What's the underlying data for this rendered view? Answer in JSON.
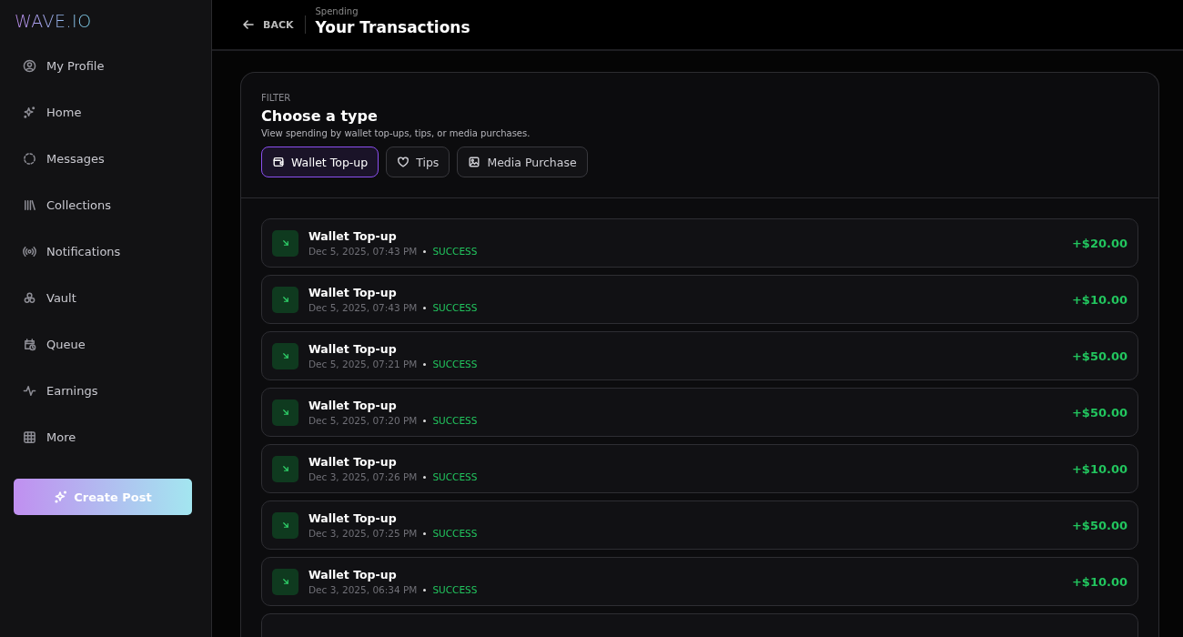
{
  "logo": "WAVE.IO",
  "sidebar": {
    "items": [
      {
        "label": "My Profile"
      },
      {
        "label": "Home"
      },
      {
        "label": "Messages"
      },
      {
        "label": "Collections"
      },
      {
        "label": "Notifications"
      },
      {
        "label": "Vault"
      },
      {
        "label": "Queue"
      },
      {
        "label": "Earnings"
      },
      {
        "label": "More"
      }
    ],
    "button": "Create Post"
  },
  "header": {
    "back": "BACK",
    "overline": "Spending",
    "title": "Your Transactions"
  },
  "filter": {
    "overline": "FILTER",
    "title": "Choose a type",
    "description": "View spending by wallet top-ups, tips, or media purchases.",
    "options": [
      {
        "label": "Wallet Top-up",
        "selected": true
      },
      {
        "label": "Tips",
        "selected": false
      },
      {
        "label": "Media Purchase",
        "selected": false
      }
    ]
  },
  "transactions": [
    {
      "title": "Wallet Top-up",
      "date": "Dec 5, 2025, 07:43 PM",
      "status": "SUCCESS",
      "amount": "+$20.00"
    },
    {
      "title": "Wallet Top-up",
      "date": "Dec 5, 2025, 07:43 PM",
      "status": "SUCCESS",
      "amount": "+$10.00"
    },
    {
      "title": "Wallet Top-up",
      "date": "Dec 5, 2025, 07:21 PM",
      "status": "SUCCESS",
      "amount": "+$50.00"
    },
    {
      "title": "Wallet Top-up",
      "date": "Dec 5, 2025, 07:20 PM",
      "status": "SUCCESS",
      "amount": "+$50.00"
    },
    {
      "title": "Wallet Top-up",
      "date": "Dec 3, 2025, 07:26 PM",
      "status": "SUCCESS",
      "amount": "+$10.00"
    },
    {
      "title": "Wallet Top-up",
      "date": "Dec 3, 2025, 07:25 PM",
      "status": "SUCCESS",
      "amount": "+$50.00"
    },
    {
      "title": "Wallet Top-up",
      "date": "Dec 3, 2025, 06:34 PM",
      "status": "SUCCESS",
      "amount": "+$10.00"
    }
  ]
}
